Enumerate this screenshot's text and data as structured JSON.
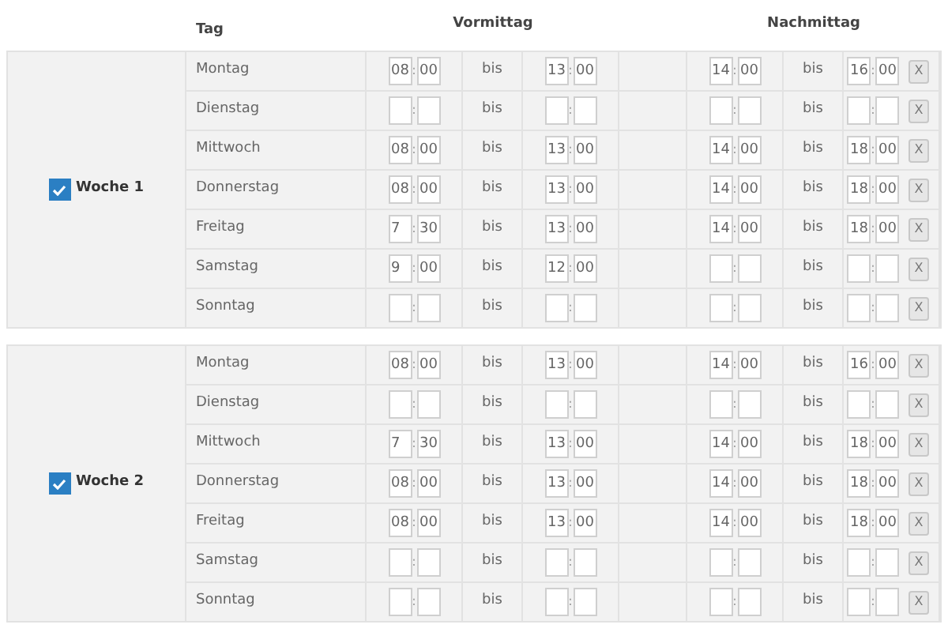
{
  "header": {
    "day": "Tag",
    "morning": "Vormittag",
    "afternoon": "Nachmittag"
  },
  "weeks": [
    {
      "label": "Woche 1",
      "checked": true,
      "rows": [
        {
          "day": "Montag",
          "am_from": {
            "h": "08",
            "sep": ":",
            "m": "00"
          },
          "am_bis": "bis",
          "am_to": {
            "h": "13",
            "sep": ":",
            "m": "00"
          },
          "pm_from": {
            "h": "14",
            "sep": ":",
            "m": "00"
          },
          "pm_bis": "bis",
          "pm_to": {
            "h": "16",
            "sep": ":",
            "m": "00"
          },
          "clear": "X"
        },
        {
          "day": "Dienstag",
          "am_from": {
            "sep": ":"
          },
          "am_bis": "bis",
          "am_to": {
            "sep": ":"
          },
          "pm_from": {
            "sep": ":"
          },
          "pm_bis": "bis",
          "pm_to": {
            "sep": ":"
          },
          "clear": "X"
        },
        {
          "day": "Mittwoch",
          "am_from": {
            "h": "08",
            "sep": ":",
            "m": "00"
          },
          "am_bis": "bis",
          "am_to": {
            "h": "13",
            "sep": ":",
            "m": "00"
          },
          "pm_from": {
            "h": "14",
            "sep": ":",
            "m": "00"
          },
          "pm_bis": "bis",
          "pm_to": {
            "h": "18",
            "sep": ":",
            "m": "00"
          },
          "clear": "X"
        },
        {
          "day": "Donnerstag",
          "am_from": {
            "h": "08",
            "sep": ":",
            "m": "00"
          },
          "am_bis": "bis",
          "am_to": {
            "h": "13",
            "sep": ":",
            "m": "00"
          },
          "pm_from": {
            "h": "14",
            "sep": ":",
            "m": "00"
          },
          "pm_bis": "bis",
          "pm_to": {
            "h": "18",
            "sep": ":",
            "m": "00"
          },
          "clear": "X"
        },
        {
          "day": "Freitag",
          "am_from": {
            "h": "7",
            "sep": ":",
            "m": "30"
          },
          "am_bis": "bis",
          "am_to": {
            "h": "13",
            "sep": ":",
            "m": "00"
          },
          "pm_from": {
            "h": "14",
            "sep": ":",
            "m": "00"
          },
          "pm_bis": "bis",
          "pm_to": {
            "h": "18",
            "sep": ":",
            "m": "00"
          },
          "clear": "X"
        },
        {
          "day": "Samstag",
          "am_from": {
            "h": "9",
            "sep": ":",
            "m": "00"
          },
          "am_bis": "bis",
          "am_to": {
            "h": "12",
            "sep": ":",
            "m": "00"
          },
          "pm_from": {
            "sep": ":"
          },
          "pm_bis": "bis",
          "pm_to": {
            "sep": ":"
          },
          "clear": "X"
        },
        {
          "day": "Sonntag",
          "am_from": {
            "sep": ":"
          },
          "am_bis": "bis",
          "am_to": {
            "sep": ":"
          },
          "pm_from": {
            "sep": ":"
          },
          "pm_bis": "bis",
          "pm_to": {
            "sep": ":"
          },
          "clear": "X"
        }
      ]
    },
    {
      "label": "Woche 2",
      "checked": true,
      "rows": [
        {
          "day": "Montag",
          "am_from": {
            "h": "08",
            "sep": ":",
            "m": "00"
          },
          "am_bis": "bis",
          "am_to": {
            "h": "13",
            "sep": ":",
            "m": "00"
          },
          "pm_from": {
            "h": "14",
            "sep": ":",
            "m": "00"
          },
          "pm_bis": "bis",
          "pm_to": {
            "h": "16",
            "sep": ":",
            "m": "00"
          },
          "clear": "X"
        },
        {
          "day": "Dienstag",
          "am_from": {
            "sep": ":"
          },
          "am_bis": "bis",
          "am_to": {
            "sep": ":"
          },
          "pm_from": {
            "sep": ":"
          },
          "pm_bis": "bis",
          "pm_to": {
            "sep": ":"
          },
          "clear": "X"
        },
        {
          "day": "Mittwoch",
          "am_from": {
            "h": "7",
            "sep": ":",
            "m": "30"
          },
          "am_bis": "bis",
          "am_to": {
            "h": "13",
            "sep": ":",
            "m": "00"
          },
          "pm_from": {
            "h": "14",
            "sep": ":",
            "m": "00"
          },
          "pm_bis": "bis",
          "pm_to": {
            "h": "18",
            "sep": ":",
            "m": "00"
          },
          "clear": "X"
        },
        {
          "day": "Donnerstag",
          "am_from": {
            "h": "08",
            "sep": ":",
            "m": "00"
          },
          "am_bis": "bis",
          "am_to": {
            "h": "13",
            "sep": ":",
            "m": "00"
          },
          "pm_from": {
            "h": "14",
            "sep": ":",
            "m": "00"
          },
          "pm_bis": "bis",
          "pm_to": {
            "h": "18",
            "sep": ":",
            "m": "00"
          },
          "clear": "X"
        },
        {
          "day": "Freitag",
          "am_from": {
            "h": "08",
            "sep": ":",
            "m": "00"
          },
          "am_bis": "bis",
          "am_to": {
            "h": "13",
            "sep": ":",
            "m": "00"
          },
          "pm_from": {
            "h": "14",
            "sep": ":",
            "m": "00"
          },
          "pm_bis": "bis",
          "pm_to": {
            "h": "18",
            "sep": ":",
            "m": "00"
          },
          "clear": "X"
        },
        {
          "day": "Samstag",
          "am_from": {
            "sep": ":"
          },
          "am_bis": "bis",
          "am_to": {
            "sep": ":"
          },
          "pm_from": {
            "sep": ":"
          },
          "pm_bis": "bis",
          "pm_to": {
            "sep": ":"
          },
          "clear": "X"
        },
        {
          "day": "Sonntag",
          "am_from": {
            "sep": ":"
          },
          "am_bis": "bis",
          "am_to": {
            "sep": ":"
          },
          "pm_from": {
            "sep": ":"
          },
          "pm_bis": "bis",
          "pm_to": {
            "sep": ":"
          },
          "clear": "X"
        }
      ]
    }
  ]
}
